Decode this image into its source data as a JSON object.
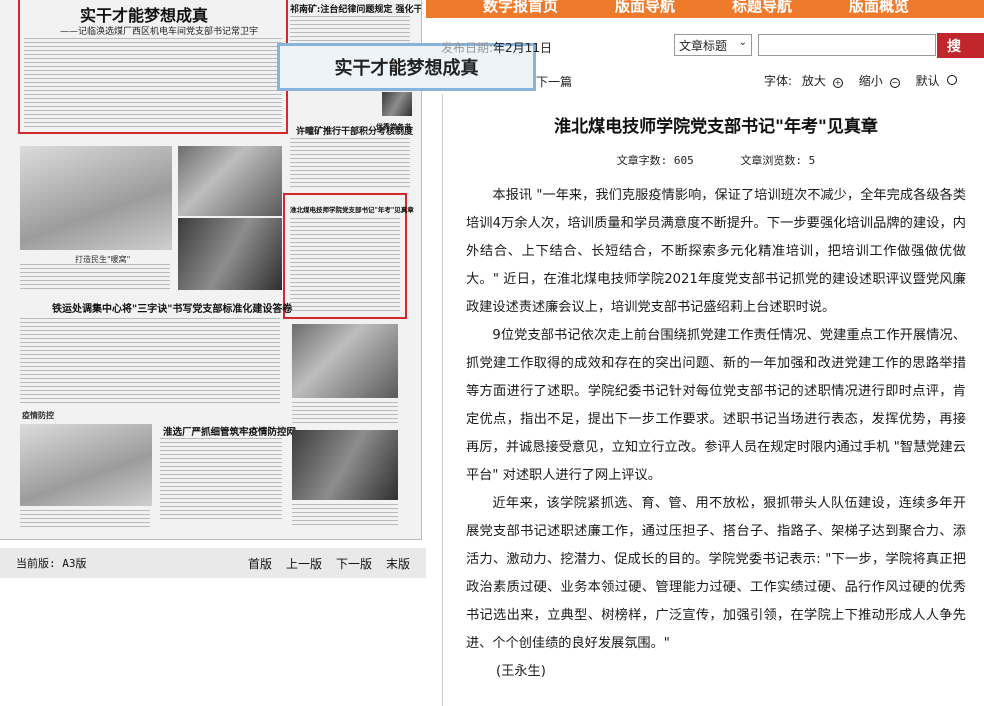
{
  "topnav": {
    "items": [
      "数字报首页",
      "版面导航",
      "标题导航",
      "版面概览"
    ]
  },
  "paper": {
    "headline_main": "实干才能梦想成真",
    "headline_sub": "——记临涣选煤厂西区机电车间党支部书记常卫宇",
    "headline_right_top": "祁南矿:注台纪律问题规定 强化干部作风建设",
    "headline_right_2": "许疃矿推行干部积分考核制度",
    "headline_highlight": "淮北煤电技师学院党支部书记\"年考\"见真章",
    "headline_mid": "铁运处调集中心将\"三字诀\"书写党支部标准化建设答卷",
    "headline_bottom": "淮选厂严抓细管筑牢疫情防控网",
    "caption_photo": "打造民生\"暖窝\"",
    "section_label": "疫情防控",
    "seal_text": "优秀党务书"
  },
  "popup": {
    "text": "实干才能梦想成真"
  },
  "page_nav": {
    "current": "当前版: A3版",
    "first": "首版",
    "prev": "上一版",
    "next": "下一版",
    "last": "末版"
  },
  "search": {
    "date_prefix": "发布日期:",
    "date": "年2月11日",
    "select_value": "文章标题",
    "button": "搜 索"
  },
  "toolbar": {
    "next_article": "下一篇",
    "font_label": "字体:",
    "zoom_in": "放大",
    "zoom_out": "缩小",
    "default": "默认"
  },
  "article": {
    "title": "淮北煤电技师学院党支部书记\"年考\"见真章",
    "word_count": "文章字数: 605",
    "views": "文章浏览数: 5",
    "paragraphs": [
      "本报讯 \"一年来，我们克服疫情影响，保证了培训班次不减少，全年完成各级各类培训4万余人次，培训质量和学员满意度不断提升。下一步要强化培训品牌的建设，内外结合、上下结合、长短结合，不断探索多元化精准培训，把培训工作做强做优做大。\" 近日，在淮北煤电技师学院2021年度党支部书记抓党的建设述职评议暨党风廉政建设述责述廉会议上，培训党支部书记盛绍莉上台述职时说。",
      "9位党支部书记依次走上前台围绕抓党建工作责任情况、党建重点工作开展情况、抓党建工作取得的成效和存在的突出问题、新的一年加强和改进党建工作的思路举措等方面进行了述职。学院纪委书记针对每位党支部书记的述职情况进行即时点评，肯定优点，指出不足，提出下一步工作要求。述职书记当场进行表态，发挥优势，再接再厉，并诚恳接受意见，立知立行立改。参评人员在规定时限内通过手机 \"智慧党建云平台\" 对述职人进行了网上评议。",
      "近年来，该学院紧抓选、育、管、用不放松，狠抓带头人队伍建设，连续多年开展党支部书记述职述廉工作，通过压担子、搭台子、指路子、架梯子达到聚合力、添活力、激动力、挖潜力、促成长的目的。学院党委书记表示: \"下一步，学院将真正把政治素质过硬、业务本领过硬、管理能力过硬、工作实绩过硬、品行作风过硬的优秀书记选出来，立典型、树榜样，广泛宣传，加强引领，在学院上下推动形成人人争先进、个个创佳绩的良好发展氛围。\""
    ],
    "author": "(王永生)"
  }
}
